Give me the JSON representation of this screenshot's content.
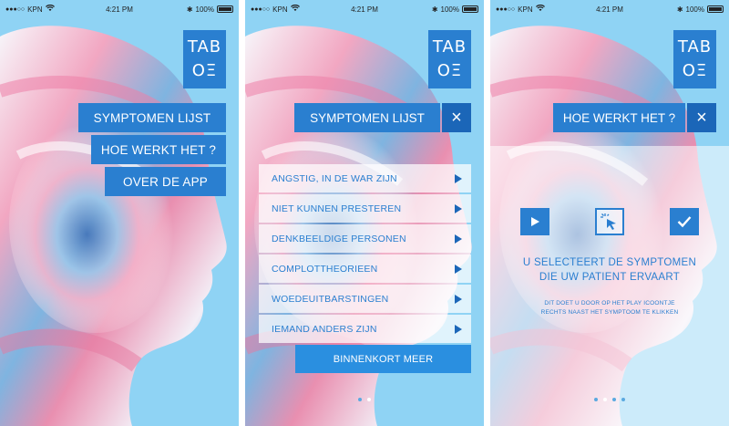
{
  "status": {
    "carrier": "KPN",
    "time": "4:21 PM",
    "battery": "100%"
  },
  "logo": {
    "line1": "TAB",
    "line2": "OΞ"
  },
  "screen1": {
    "menu": [
      {
        "label": "SYMPTOMEN LIJST"
      },
      {
        "label": "HOE WERKT HET ?"
      },
      {
        "label": "OVER DE APP"
      }
    ]
  },
  "screen2": {
    "title": "SYMPTOMEN LIJST",
    "close": "×",
    "items": [
      {
        "label": "ANGSTIG, IN DE WAR ZIJN"
      },
      {
        "label": "NIET KUNNEN PRESTEREN"
      },
      {
        "label": "DENKBEELDIGE PERSONEN"
      },
      {
        "label": "COMPLOTTHEORIEEN"
      },
      {
        "label": "WOEDEUITBARSTINGEN"
      },
      {
        "label": "IEMAND ANDERS ZIJN"
      }
    ],
    "more_label": "BINNENKORT MEER"
  },
  "screen3": {
    "title": "HOE WERKT HET ?",
    "close": "×",
    "headline_line1": "U SELECTEERT DE SYMPTOMEN",
    "headline_line2": "DIE UW PATIENT ERVAART",
    "small_line1": "DIT DOET U DOOR OP HET PLAY ICOONTJE",
    "small_line2": "RECHTS NAAST HET SYMPTOOM TE KLIKKEN"
  },
  "colors": {
    "background": "#8fd3f4",
    "accent": "#2a7fd0",
    "accent_dark": "#1b66b8"
  }
}
